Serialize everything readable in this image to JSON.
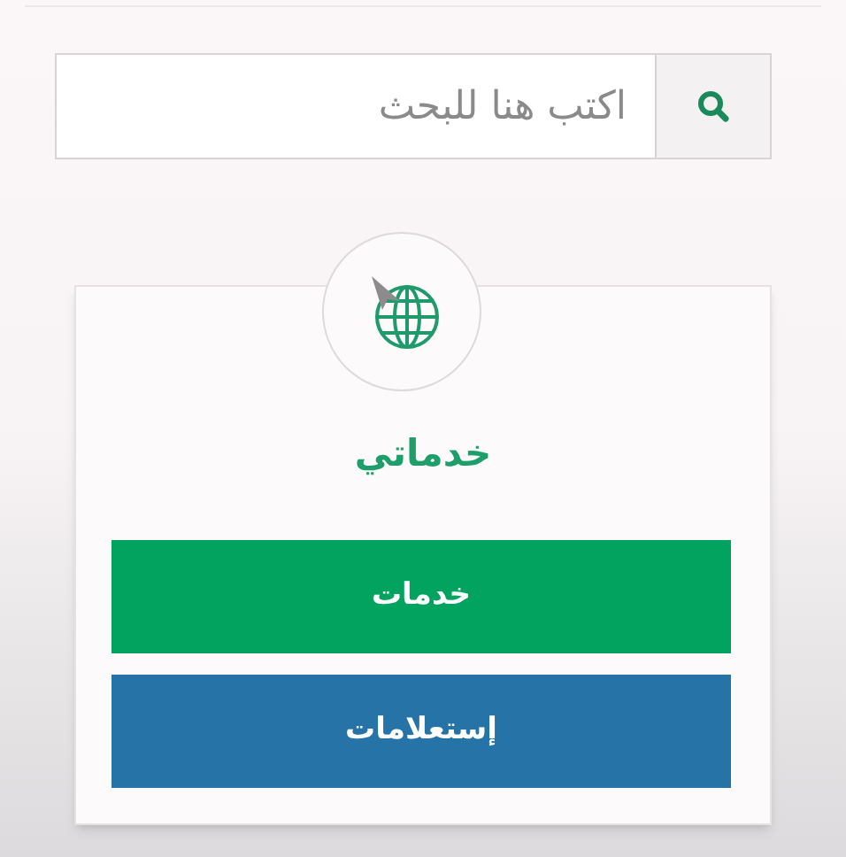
{
  "search": {
    "placeholder": "اكتب هنا للبحث"
  },
  "card": {
    "title": "خدماتي",
    "buttons": [
      {
        "label": "خدمات",
        "color": "#02a35e"
      },
      {
        "label": "إستعلامات",
        "color": "#2673a8"
      }
    ]
  }
}
